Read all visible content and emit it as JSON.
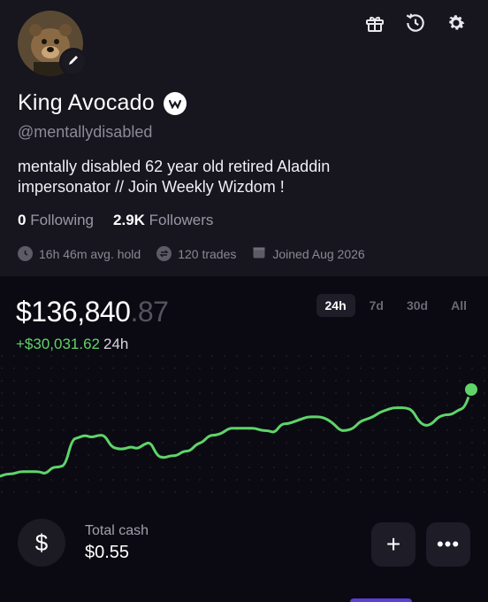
{
  "profile": {
    "name": "King Avocado",
    "handle": "@mentallydisabled",
    "bio": "mentally disabled 62 year old retired Aladdin impersonator  // Join Weekly Wizdom !",
    "following_count": "0",
    "following_label": "Following",
    "followers_count": "2.9K",
    "followers_label": "Followers",
    "meta": {
      "avg_hold": "16h 46m avg. hold",
      "trades": "120 trades",
      "joined": "Joined Aug 2026"
    },
    "icons": [
      "gift-icon",
      "history-icon",
      "settings-icon",
      "edit-icon",
      "verified-badge-icon"
    ]
  },
  "portfolio": {
    "value_main": "$136,840",
    "value_cents": ".87",
    "change": "+$30,031.62",
    "change_period": "24h",
    "tabs": [
      "24h",
      "7d",
      "30d",
      "All"
    ],
    "active_tab": "24h",
    "accent_color": "#5fd46a"
  },
  "chart_data": {
    "type": "line",
    "series": [
      {
        "values": [
          100,
          101,
          101,
          102,
          102,
          102,
          102,
          101,
          104,
          104,
          105,
          116,
          117,
          118,
          117,
          118,
          118,
          113,
          112,
          112,
          113,
          112,
          114,
          115,
          109,
          108,
          109,
          109,
          111,
          111,
          114,
          115,
          118,
          118,
          119,
          121,
          121,
          121,
          121,
          121,
          120,
          120,
          119,
          123,
          123,
          124,
          125,
          126,
          126,
          126,
          125,
          123,
          120,
          120,
          121,
          124,
          125,
          126,
          128,
          129,
          130,
          130,
          130,
          129,
          124,
          122,
          123,
          126,
          127,
          127,
          129,
          130,
          138
        ]
      }
    ],
    "grid": true,
    "end_marker": true
  },
  "cash": {
    "label": "Total cash",
    "value": "$0.55",
    "icon": "$"
  },
  "actions": {
    "add": "+",
    "more": "•••"
  }
}
